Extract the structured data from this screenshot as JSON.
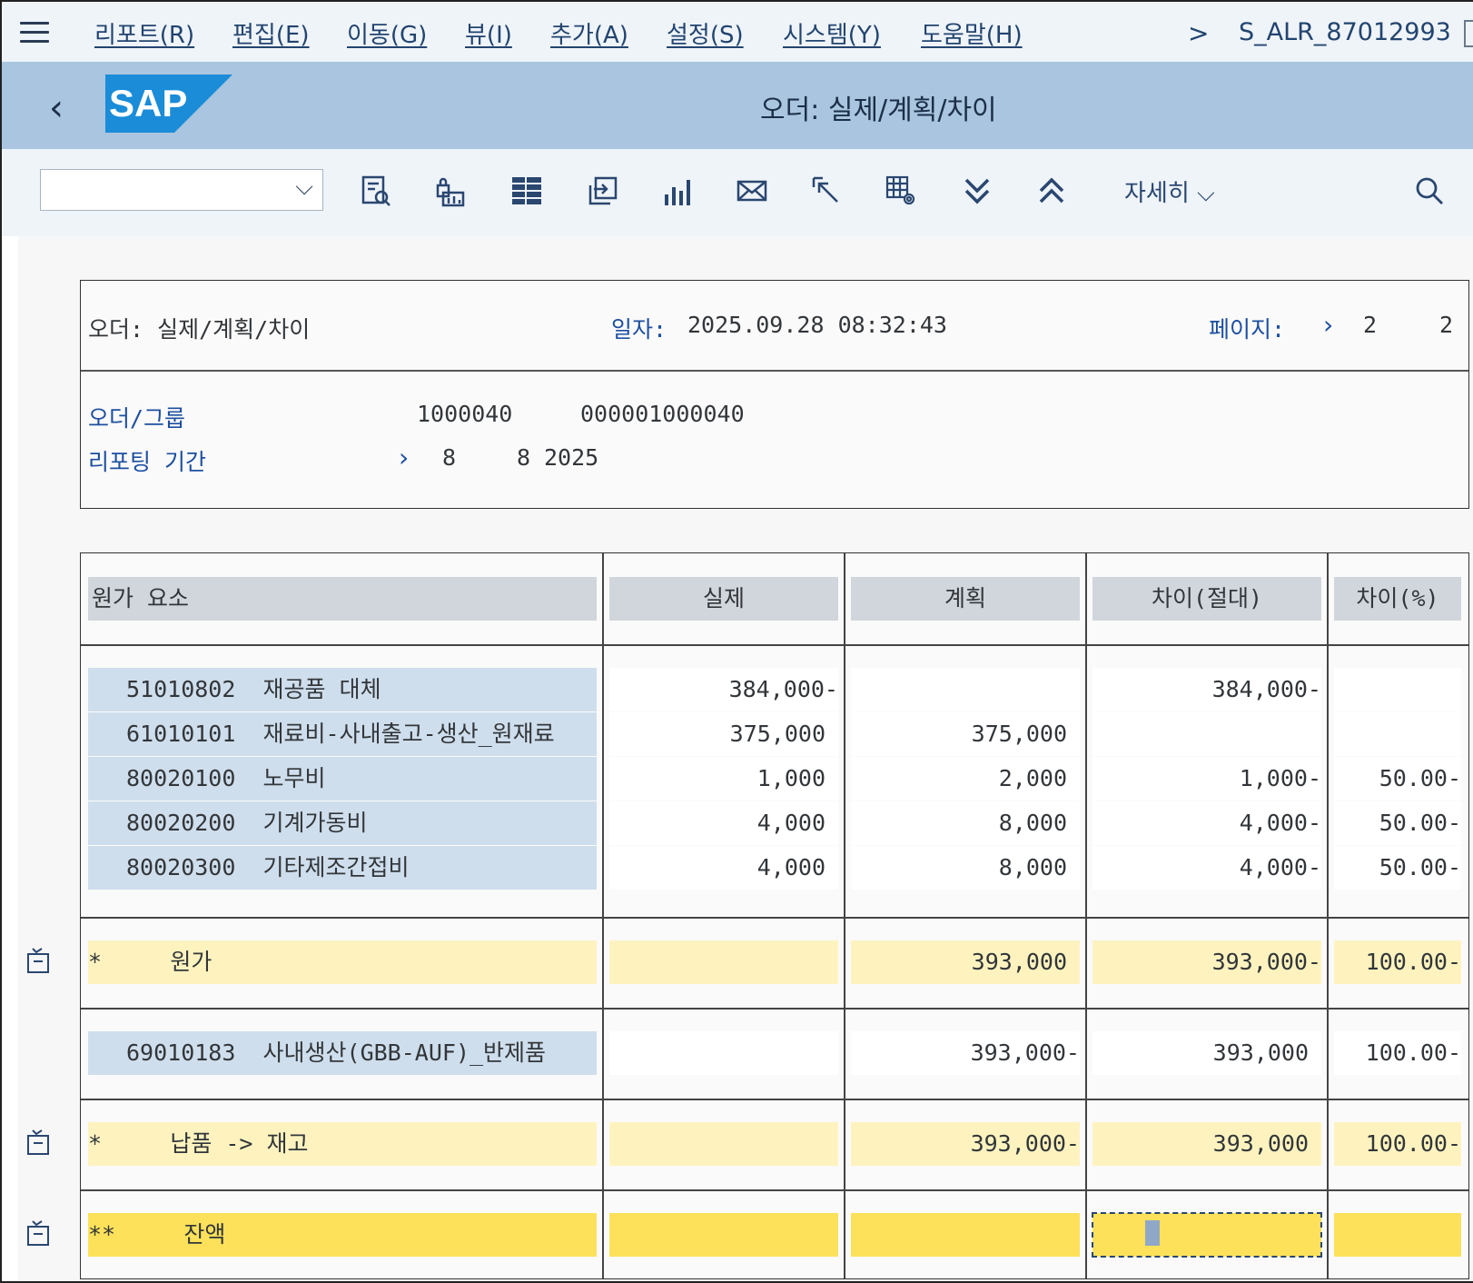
{
  "menu": {
    "items": [
      "리포트(R)",
      "편집(E)",
      "이동(G)",
      "뷰(I)",
      "추가(A)",
      "설정(S)",
      "시스템(Y)",
      "도움말(H)"
    ],
    "tcode": "S_ALR_87012993"
  },
  "titlebar": {
    "logo_text": "SAP",
    "title": "오더: 실제/계획/차이"
  },
  "toolbar": {
    "dropdown_value": "",
    "icons": [
      "report-list-icon",
      "lock-chart-icon",
      "table-layout-icon",
      "export-icon",
      "bar-chart-icon",
      "mail-icon",
      "select-cursor-icon",
      "grid-settings-icon",
      "expand-all-icon",
      "collapse-all-icon"
    ],
    "more_label": "자세히",
    "search_icon": "search-icon"
  },
  "report_header": {
    "title": "오더: 실제/계획/차이",
    "date_label": "일자:",
    "date_value": "2025.09.28 08:32:43",
    "page_label": "페이지:",
    "page_current": "2",
    "page_total": "2",
    "order_group_label": "오더/그룹",
    "order_group_value1": "1000040",
    "order_group_value2": "000001000040",
    "period_label": "리포팅 기간",
    "period_from": "8",
    "period_to": "8",
    "period_year": "2025"
  },
  "table": {
    "headers": [
      "원가 요소",
      "실제",
      "계획",
      "차이(절대)",
      "차이(%)"
    ],
    "rows": [
      {
        "code": "51010802",
        "name": "재공품 대체",
        "actual": "384,000-",
        "plan": "",
        "var_abs": "384,000-",
        "var_pct": ""
      },
      {
        "code": "61010101",
        "name": "재료비-사내출고-생산_원재료",
        "actual": "375,000",
        "plan": "375,000",
        "var_abs": "",
        "var_pct": ""
      },
      {
        "code": "80020100",
        "name": "노무비",
        "actual": "1,000",
        "plan": "2,000",
        "var_abs": "1,000-",
        "var_pct": "50.00-"
      },
      {
        "code": "80020200",
        "name": "기계가동비",
        "actual": "4,000",
        "plan": "8,000",
        "var_abs": "4,000-",
        "var_pct": "50.00-"
      },
      {
        "code": "80020300",
        "name": "기타제조간접비",
        "actual": "4,000",
        "plan": "8,000",
        "var_abs": "4,000-",
        "var_pct": "50.00-"
      }
    ],
    "subtotal1": {
      "marker": "*",
      "label": "원가",
      "actual": "",
      "plan": "393,000",
      "var_abs": "393,000-",
      "var_pct": "100.00-"
    },
    "row2": {
      "code": "69010183",
      "name": "사내생산(GBB-AUF)_반제품",
      "actual": "",
      "plan": "393,000-",
      "var_abs": "393,000",
      "var_pct": "100.00-"
    },
    "subtotal2": {
      "marker": "*",
      "label": "납품 -> 재고",
      "actual": "",
      "plan": "393,000-",
      "var_abs": "393,000",
      "var_pct": "100.00-"
    },
    "total": {
      "marker": "**",
      "label": "잔액",
      "actual": "",
      "plan": "",
      "var_abs": "",
      "var_pct": ""
    }
  }
}
